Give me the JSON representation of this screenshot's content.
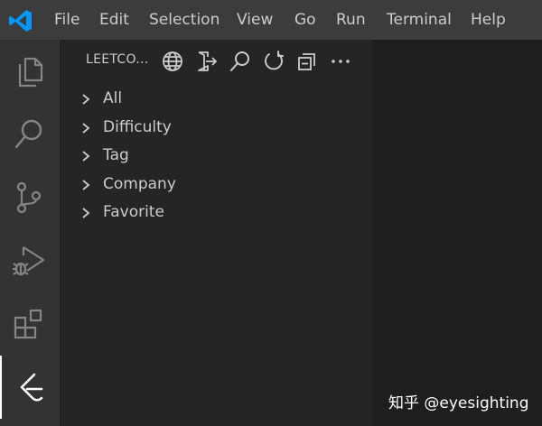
{
  "menu": {
    "items": [
      {
        "label": "File"
      },
      {
        "label": "Edit"
      },
      {
        "label": "Selection"
      },
      {
        "label": "View"
      },
      {
        "label": "Go"
      },
      {
        "label": "Run"
      },
      {
        "label": "Terminal"
      },
      {
        "label": "Help"
      }
    ]
  },
  "activity_bar": {
    "items": [
      {
        "name": "explorer",
        "icon": "files-icon"
      },
      {
        "name": "search",
        "icon": "search-icon"
      },
      {
        "name": "source-control",
        "icon": "source-control-icon"
      },
      {
        "name": "run-and-debug",
        "icon": "run-debug-icon"
      },
      {
        "name": "extensions",
        "icon": "extensions-icon"
      },
      {
        "name": "leetcode",
        "icon": "leetcode-icon",
        "active": true
      }
    ]
  },
  "sidebar": {
    "title": "LEETCO...",
    "toolbar": [
      {
        "icon": "globe-icon"
      },
      {
        "icon": "sign-out-icon"
      },
      {
        "icon": "search-icon"
      },
      {
        "icon": "refresh-icon"
      },
      {
        "icon": "collapse-all-icon"
      },
      {
        "icon": "more-icon"
      }
    ],
    "tree": [
      {
        "label": "All"
      },
      {
        "label": "Difficulty"
      },
      {
        "label": "Tag"
      },
      {
        "label": "Company"
      },
      {
        "label": "Favorite"
      }
    ]
  },
  "watermark": {
    "text": "知乎 @eyesighting"
  },
  "colors": {
    "titlebar": "#3c3c3c",
    "activitybar": "#333333",
    "sidebar": "#252526",
    "editor": "#1e1e1e",
    "accent": "#0098ff",
    "icon_inactive": "#858585",
    "icon_active": "#ffffff"
  }
}
